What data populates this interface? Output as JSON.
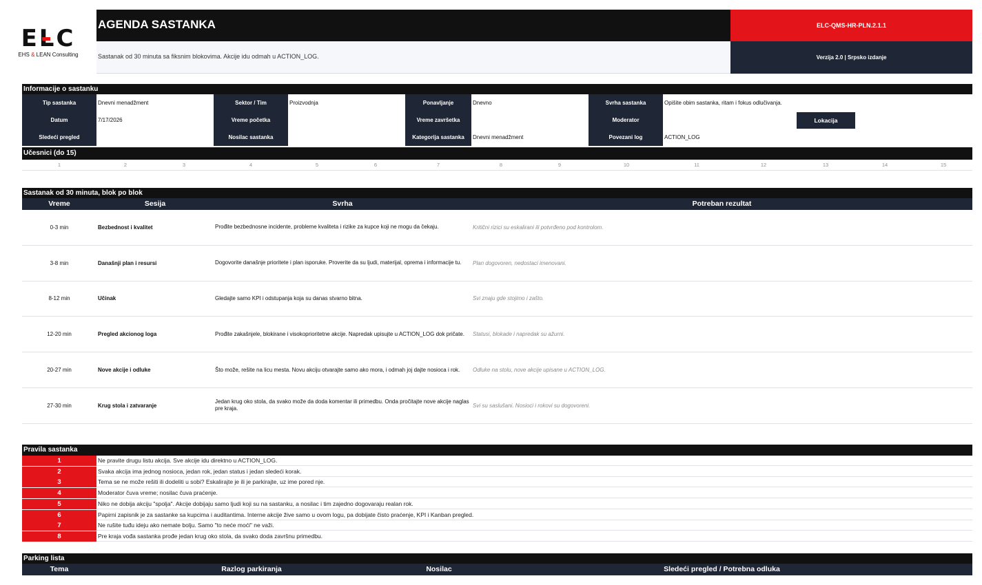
{
  "header": {
    "logo_letters": "ELC",
    "logo_tag_1": "EHS",
    "logo_tag_amp": "&",
    "logo_tag_2": "LEAN Consulting",
    "title": "AGENDA SASTANKA",
    "doc_code": "ELC-QMS-HR-PLN.2.1.1",
    "subtitle": "Sastanak od 30 minuta sa fiksnim blokovima. Akcije idu odmah u ACTION_LOG.",
    "version": "Verzija 2.0 | Srpsko izdanje"
  },
  "info": {
    "section_title": "Informacije o sastanku",
    "labels": {
      "tip": "Tip sastanka",
      "sektor": "Sektor / Tim",
      "ponavljanje": "Ponavljanje",
      "svrha": "Svrha sastanka",
      "datum": "Datum",
      "vreme_pocetka": "Vreme početka",
      "vreme_zavrsetka": "Vreme završetka",
      "moderator": "Moderator",
      "sledeci": "Sledeći pregled",
      "nosilac": "Nosilac sastanka",
      "kategorija": "Kategorija sastanka",
      "log": "Povezani log"
    },
    "values": {
      "tip": "Dnevni menadžment",
      "sektor": "Proizvodnja",
      "ponavljanje": "Dnevno",
      "svrha": "Opišite obim sastanka, ritam i fokus odlučivanja.",
      "datum": "7/17/2026",
      "vreme_pocetka": "",
      "vreme_zavrsetka": "",
      "moderator": "",
      "sledeci": "",
      "nosilac": "",
      "kategorija": "Dnevni menadžment",
      "log": "ACTION_LOG"
    },
    "location_button": "Lokacija"
  },
  "participants": {
    "section_title": "Učesnici (do 15)",
    "numbers": [
      "1",
      "2",
      "3",
      "4",
      "5",
      "6",
      "7",
      "8",
      "9",
      "10",
      "11",
      "12",
      "13",
      "14",
      "15"
    ]
  },
  "agenda": {
    "section_title": "Sastanak od 30 minuta, blok po blok",
    "columns": {
      "time": "Vreme",
      "session": "Sesija",
      "purpose": "Svrha",
      "result": "Potreban rezultat"
    },
    "blocks": [
      {
        "time": "0-3 min",
        "session": "Bezbednost i kvalitet",
        "purpose": "Prođite bezbednosne incidente, probleme kvaliteta i rizike za kupce koji ne mogu da čekaju.",
        "result": "Kritični rizici su eskalirani ili potvrđeno pod kontrolom."
      },
      {
        "time": "3-8 min",
        "session": "Današnji plan i resursi",
        "purpose": "Dogovorite današnje prioritete i plan isporuke. Proverite da su ljudi, materijal, oprema i informacije tu.",
        "result": "Plan dogovoren, nedostaci imenovani."
      },
      {
        "time": "8-12 min",
        "session": "Učinak",
        "purpose": "Gledajte samo KPI i odstupanja koja su danas stvarno bitna.",
        "result": "Svi znaju gde stojimo i zašto."
      },
      {
        "time": "12-20 min",
        "session": "Pregled akcionog loga",
        "purpose": "Prođite zakašnjele, blokirane i visokoprioritetne akcije. Napredak upisujte u ACTION_LOG dok pričate.",
        "result": "Statusi, blokade i napredak su ažurni."
      },
      {
        "time": "20-27 min",
        "session": "Nove akcije i odluke",
        "purpose": "Što može, rešite na licu mesta. Novu akciju otvarajte samo ako mora, i odmah joj dajte nosioca i rok.",
        "result": "Odluke na stolu, nove akcije upisane u ACTION_LOG."
      },
      {
        "time": "27-30 min",
        "session": "Krug stola i zatvaranje",
        "purpose": "Jedan krug oko stola, da svako može da doda komentar ili primedbu. Onda pročitajte nove akcije naglas pre kraja.",
        "result": "Svi su saslušani. Nosioci i rokovi su dogovoreni."
      }
    ]
  },
  "rules": {
    "section_title": "Pravila sastanka",
    "items": [
      {
        "num": "1",
        "text": "Ne pravite drugu listu akcija. Sve akcije idu direktno u ACTION_LOG."
      },
      {
        "num": "2",
        "text": "Svaka akcija ima jednog nosioca, jedan rok, jedan status i jedan sledeći korak."
      },
      {
        "num": "3",
        "text": "Tema se ne može rešiti ili dodeliti u sobi? Eskalirajte je ili je parkirajte, uz ime pored nje."
      },
      {
        "num": "4",
        "text": "Moderator čuva vreme; nosilac čuva praćenje."
      },
      {
        "num": "5",
        "text": "Niko ne dobija akciju \"spolja\". Akcije dobijaju samo ljudi koji su na sastanku, a nosilac i tim zajedno dogovaraju realan rok."
      },
      {
        "num": "6",
        "text": "Papirni zapisnik je za sastanke sa kupcima i auditantima. Interne akcije žive samo u ovom logu, pa dobijate čisto praćenje, KPI i Kanban pregled."
      },
      {
        "num": "7",
        "text": "Ne rušite tuđu ideju ako nemate bolju. Samo \"to neće moći\" ne važi."
      },
      {
        "num": "8",
        "text": "Pre kraja vođa sastanka prođe jedan krug oko stola, da svako doda završnu primedbu."
      }
    ]
  },
  "parking": {
    "section_title": "Parking lista",
    "columns": {
      "topic": "Tema",
      "reason": "Razlog parkiranja",
      "owner": "Nosilac",
      "next": "Sledeći pregled / Potrebna odluka"
    }
  },
  "colors": {
    "dark": "#111111",
    "navy": "#1f2635",
    "red": "#e3151a",
    "muted": "#8a8f96"
  }
}
